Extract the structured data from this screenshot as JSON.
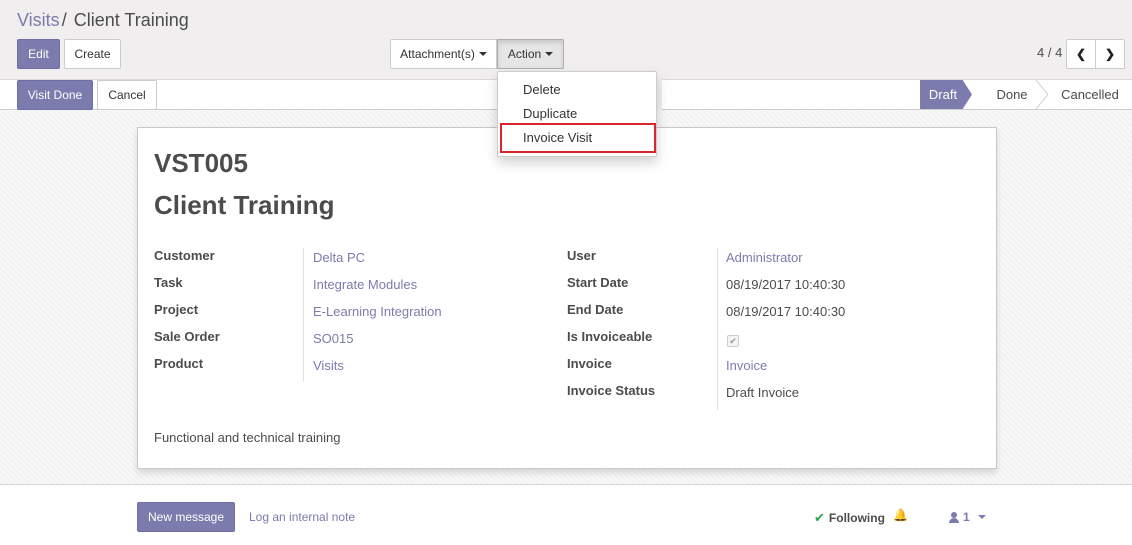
{
  "breadcrumb": {
    "parent": "Visits",
    "separator": "/",
    "current": "Client Training"
  },
  "toolbar": {
    "edit": "Edit",
    "create": "Create",
    "attachments": "Attachment(s)",
    "action": "Action"
  },
  "pager": {
    "value": "4 / 4"
  },
  "action_menu": {
    "items": [
      "Delete",
      "Duplicate",
      "Invoice Visit"
    ],
    "highlighted": "Invoice Visit"
  },
  "statusbar": {
    "buttons": {
      "visit_done": "Visit Done",
      "cancel": "Cancel"
    },
    "stages": [
      "Draft",
      "Done",
      "Cancelled"
    ],
    "active_stage": "Draft"
  },
  "record": {
    "reference": "VST005",
    "name": "Client Training",
    "left": [
      {
        "label": "Customer",
        "value": "Delta PC"
      },
      {
        "label": "Task",
        "value": "Integrate Modules"
      },
      {
        "label": "Project",
        "value": "E-Learning Integration"
      },
      {
        "label": "Sale Order",
        "value": "SO015"
      },
      {
        "label": "Product",
        "value": "Visits"
      }
    ],
    "right": [
      {
        "label": "User",
        "value": "Administrator"
      },
      {
        "label": "Start Date",
        "value": "08/19/2017 10:40:30"
      },
      {
        "label": "End Date",
        "value": "08/19/2017 10:40:30"
      },
      {
        "label": "Is Invoiceable",
        "value": true
      },
      {
        "label": "Invoice",
        "value": "Invoice"
      },
      {
        "label": "Invoice Status",
        "value": "Draft Invoice"
      }
    ],
    "notes": "Functional and technical training"
  },
  "chatter": {
    "new_message": "New message",
    "log_note": "Log an internal note",
    "following": "Following",
    "followers_count": "1"
  },
  "colors": {
    "primary": "#7c7bad",
    "highlight_border": "#d9252b",
    "follow_check": "#28a745"
  },
  "icons": {
    "check": "check-icon",
    "bell": "bell-icon",
    "user": "user-icon",
    "prev": "chevron-left-icon",
    "next": "chevron-right-icon"
  }
}
